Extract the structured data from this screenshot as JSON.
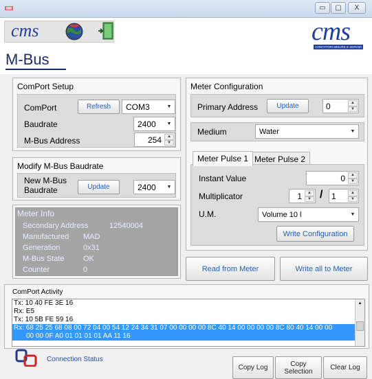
{
  "window": {
    "minimize_glyph": "▭",
    "maximize_glyph": "▢",
    "close_glyph": "X"
  },
  "header": {
    "logo_left": "cms",
    "logo_right": "cms",
    "logo_right_tagline": "CONTATORI MISURE E SERVIZI",
    "app_title": "M-Bus"
  },
  "comport_setup": {
    "title": "ComPort Setup",
    "comport_label": "ComPort",
    "refresh_label": "Refresh",
    "comport_value": "COM3",
    "baudrate_label": "Baudrate",
    "baudrate_value": "2400",
    "address_label": "M-Bus Address",
    "address_value": "254"
  },
  "modify_baudrate": {
    "title": "Modify M-Bus Baudrate",
    "new_label_line1": "New M-Bus",
    "new_label_line2": "Baudrate",
    "update_label": "Update",
    "value": "2400"
  },
  "meter_info": {
    "title": "Meter Info",
    "rows": [
      {
        "key": "Secondary Address",
        "value": "12540004"
      },
      {
        "key": "Manufactured",
        "value": "MAD"
      },
      {
        "key": "Generation",
        "value": "0x31"
      },
      {
        "key": "M-Bus State",
        "value": "OK"
      },
      {
        "key": "Counter",
        "value": "0"
      }
    ]
  },
  "meter_config": {
    "title": "Meter Configuration",
    "primary_label": "Primary Address",
    "update_label": "Update",
    "primary_value": "0",
    "medium_label": "Medium",
    "medium_value": "Water",
    "tabs": [
      "Meter Pulse 1",
      "Meter Pulse 2"
    ],
    "instant_label": "Instant Value",
    "instant_value": "0",
    "multiplicator_label": "Multiplicator",
    "mult_num": "1",
    "mult_sep": "/",
    "mult_den": "1",
    "um_label": "U.M.",
    "um_value": "Volume 10 l",
    "write_config_label": "Write Configuration"
  },
  "actions": {
    "read_label": "Read from Meter",
    "write_all_label": "Write all to Meter"
  },
  "activity": {
    "title": "ComPort Activity",
    "lines": [
      "Tx: 10 40 FE 3E 16",
      "Rx: E5",
      "Tx: 10 5B FE 59 16"
    ],
    "selected_line1": "Rx: 68 25 25 68 08 00 72 04 00 54 12 24 34 31 07 00 00 00 00 8C 40 14 00 00 00 00 8C 80 40 14 00 00",
    "selected_line2": "00 00 0F A0 01 01 01 01 AA 11 16"
  },
  "footer": {
    "connection_status": "Connection Status",
    "copy_log": "Copy Log",
    "copy_selection_line1": "Copy",
    "copy_selection_line2": "Selection",
    "clear_log": "Clear Log"
  },
  "colors": {
    "accent_blue": "#1f5fbf",
    "selection": "#3399ff",
    "status_blue": "#1a3a8a",
    "status_red": "#d42020"
  }
}
